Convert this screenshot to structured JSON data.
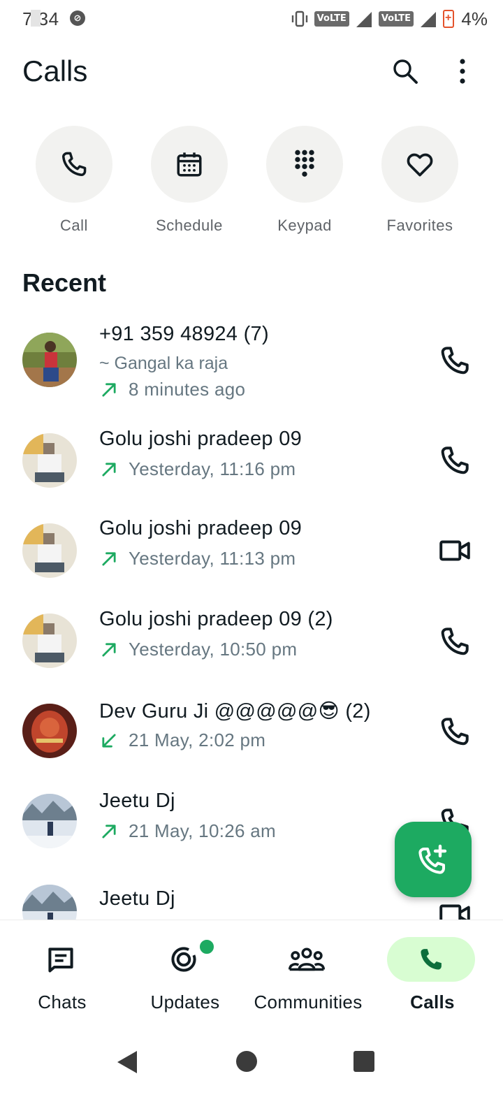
{
  "status": {
    "time": "7 34",
    "battery_pct": "4%",
    "volte1": "VoLTE",
    "volte2": "VoLTE"
  },
  "header": {
    "title": "Calls"
  },
  "quick_actions": [
    {
      "label": "Call",
      "icon": "phone-icon"
    },
    {
      "label": "Schedule",
      "icon": "calendar-icon"
    },
    {
      "label": "Keypad",
      "icon": "dialpad-icon"
    },
    {
      "label": "Favorites",
      "icon": "heart-icon"
    }
  ],
  "recent": {
    "title": "Recent",
    "calls": [
      {
        "name": "+91 359 48924",
        "count": "(7)",
        "subtitle": "~ Gangal ka raja",
        "time": "8 minutes ago",
        "direction": "outgoing",
        "type": "voice"
      },
      {
        "name": "Golu joshi pradeep 09",
        "count": "",
        "subtitle": "",
        "time": "Yesterday, 11:16 pm",
        "direction": "outgoing",
        "type": "voice"
      },
      {
        "name": "Golu joshi pradeep 09",
        "count": "",
        "subtitle": "",
        "time": "Yesterday, 11:13 pm",
        "direction": "outgoing",
        "type": "video"
      },
      {
        "name": "Golu joshi pradeep 09",
        "count": "(2)",
        "subtitle": "",
        "time": "Yesterday, 10:50 pm",
        "direction": "outgoing",
        "type": "voice"
      },
      {
        "name": "Dev Guru Ji @@@@@😎",
        "count": "(2)",
        "subtitle": "",
        "time": "21 May, 2:02 pm",
        "direction": "incoming",
        "type": "voice"
      },
      {
        "name": "Jeetu Dj",
        "count": "",
        "subtitle": "",
        "time": "21 May, 10:26 am",
        "direction": "outgoing",
        "type": "voice"
      },
      {
        "name": "Jeetu Dj",
        "count": "",
        "subtitle": "",
        "time": "",
        "direction": "outgoing",
        "type": "video"
      }
    ]
  },
  "bottom_nav": {
    "chats": "Chats",
    "updates": "Updates",
    "communities": "Communities",
    "calls": "Calls"
  },
  "colors": {
    "accent": "#1daa61",
    "active_pill": "#d8fdd2",
    "text_primary": "#111b21",
    "text_secondary": "#667781"
  }
}
